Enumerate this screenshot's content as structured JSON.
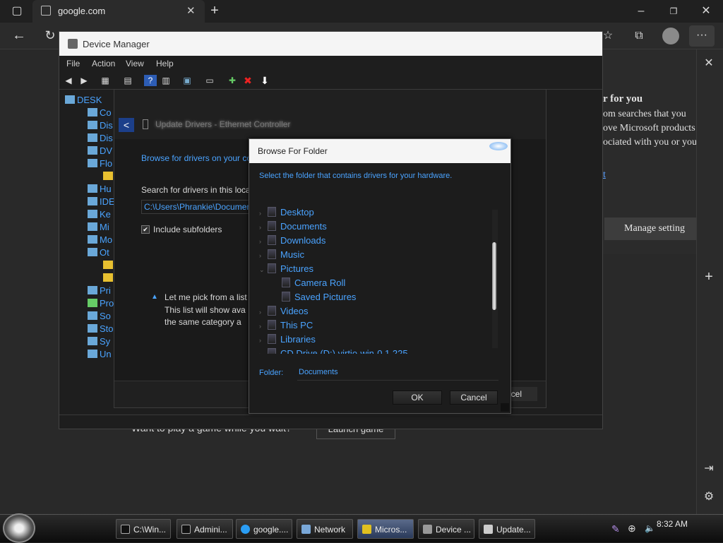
{
  "browser": {
    "tab_title": "google.com",
    "tab_favicon": "google-icon"
  },
  "side_panel": {
    "heading": "r for you",
    "lines": [
      "om searches that you",
      "ove Microsoft products and",
      "ociated with you or your",
      "t"
    ],
    "manage_button": "Manage setting"
  },
  "page": {
    "game_prompt": "Want to play a game while you wait?",
    "launch_button": "Launch game"
  },
  "device_manager": {
    "title": "Device Manager",
    "menu": [
      "File",
      "Action",
      "View",
      "Help"
    ],
    "tree": [
      {
        "label": "DESK"
      },
      {
        "label": "Co"
      },
      {
        "label": "Dis"
      },
      {
        "label": "Dis"
      },
      {
        "label": "DV"
      },
      {
        "label": "Flo"
      },
      {
        "label": ""
      },
      {
        "label": "Hu"
      },
      {
        "label": "IDE"
      },
      {
        "label": "Ke"
      },
      {
        "label": "Mi"
      },
      {
        "label": "Mo"
      },
      {
        "label": "Ot"
      },
      {
        "label": ""
      },
      {
        "label": ""
      },
      {
        "label": "Pri"
      },
      {
        "label": "Pro"
      },
      {
        "label": "So"
      },
      {
        "label": "Sto"
      },
      {
        "label": "Sy"
      },
      {
        "label": "Un"
      }
    ]
  },
  "wizard": {
    "title": "Update Drivers - Ethernet Controller",
    "browse_heading": "Browse for drivers on your co",
    "search_label": "Search for drivers in this locat",
    "path_value": "C:\\Users\\Phrankie\\Documer",
    "include_subfolders": "Include subfolders",
    "pick_title": "Let me pick from a list",
    "pick_line1": "This list will show ava",
    "pick_line2": "the same category a",
    "cancel_label": "ncel"
  },
  "browse_dialog": {
    "title": "Browse For Folder",
    "instruction": "Select the folder that contains drivers for your hardware.",
    "folders": [
      {
        "label": "Desktop",
        "level": 0,
        "expander": "›"
      },
      {
        "label": "Documents",
        "level": 0,
        "expander": "›"
      },
      {
        "label": "Downloads",
        "level": 0,
        "expander": "›"
      },
      {
        "label": "Music",
        "level": 0,
        "expander": "›"
      },
      {
        "label": "Pictures",
        "level": 0,
        "expander": "⌄"
      },
      {
        "label": "Camera Roll",
        "level": 1,
        "expander": ""
      },
      {
        "label": "Saved Pictures",
        "level": 1,
        "expander": ""
      },
      {
        "label": "Videos",
        "level": 0,
        "expander": "›"
      },
      {
        "label": "This PC",
        "level": 0,
        "expander": "›"
      },
      {
        "label": "Libraries",
        "level": 0,
        "expander": "›"
      },
      {
        "label": "CD Drive (D:) virtio-win-0.1.225",
        "level": 0,
        "expander": "›"
      }
    ],
    "folder_label": "Folder:",
    "folder_value": "Documents",
    "ok_label": "OK",
    "cancel_label": "Cancel"
  },
  "taskbar": {
    "items": [
      {
        "label": "C:\\Win..."
      },
      {
        "label": "Admini..."
      },
      {
        "label": "google...."
      },
      {
        "label": "Network"
      },
      {
        "label": "Micros..."
      },
      {
        "label": "Device ..."
      },
      {
        "label": "Update..."
      }
    ],
    "clock": "8:32 AM"
  }
}
